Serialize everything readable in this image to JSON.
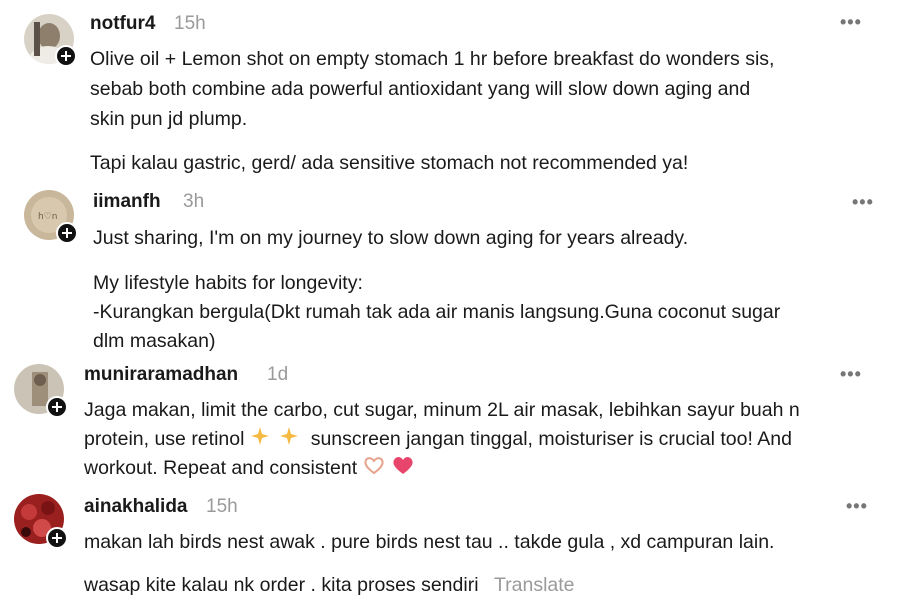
{
  "comments": [
    {
      "username": "notfur4",
      "time": "15h",
      "more": "•••",
      "lines": [
        "Olive oil + Lemon shot on empty stomach 1 hr before breakfast do wonders sis,",
        "sebab both combine ada powerful antioxidant yang will slow down aging and",
        "skin pun jd plump.",
        "Tapi kalau gastric, gerd/ ada sensitive stomach not recommended ya!"
      ]
    },
    {
      "username": "iimanfh",
      "time": "3h",
      "more": "•••",
      "lines": [
        "Just sharing, I'm on my journey to slow down aging for years already.",
        "My lifestyle habits for longevity:",
        "-Kurangkan bergula(Dkt rumah tak ada air manis langsung.Guna coconut sugar",
        "dlm masakan)"
      ]
    },
    {
      "username": "muniraramadhan",
      "time": "1d",
      "more": "•••",
      "lines": [
        "Jaga makan, limit the carbo, cut sugar, minum 2L air masak, lebihkan sayur buah n",
        "protein, use retinol",
        "sunscreen jangan tinggal, moisturiser is crucial too! And",
        "workout. Repeat and consistent"
      ]
    },
    {
      "username": "ainakhalida",
      "time": "15h",
      "more": "•••",
      "lines": [
        "makan lah birds nest awak . pure birds nest tau .. takde gula , xd campuran lain.",
        "wasap kite kalau nk order . kita proses sendiri"
      ],
      "translate": "Translate"
    }
  ]
}
